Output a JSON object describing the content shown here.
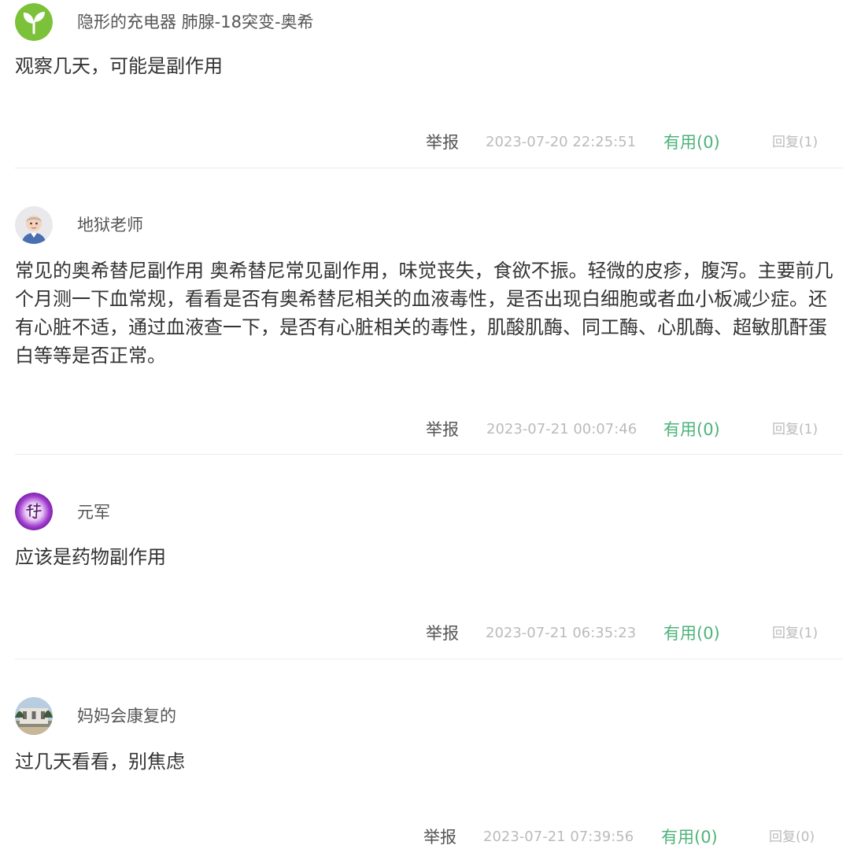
{
  "comments": [
    {
      "avatar": "leaf-sprout-avatar",
      "username": "隐形的充电器 肺腺-18突变-奥希",
      "content": "观察几天，可能是副作用",
      "report_label": "举报",
      "timestamp": "2023-07-20 22:25:51",
      "useful_label": "有用(0)",
      "reply_label": "回复(1)"
    },
    {
      "avatar": "baby-photo-avatar",
      "username": "地狱老师",
      "content": "常见的奥希替尼副作用 奥希替尼常见副作用，味觉丧失，食欲不振。轻微的皮疹，腹泻。主要前几个月测一下血常规，看看是否有奥希替尼相关的血液毒性，是否出现白细胞或者血小板减少症。还有心脏不适，通过血液查一下，是否有心脏相关的毒性，肌酸肌酶、同工酶、心肌酶、超敏肌酐蛋白等等是否正常。",
      "report_label": "举报",
      "timestamp": "2023-07-21 00:07:46",
      "useful_label": "有用(0)",
      "reply_label": "回复(1)"
    },
    {
      "avatar": "purple-calligraphy-avatar",
      "username": "元军",
      "content": "应该是药物副作用",
      "report_label": "举报",
      "timestamp": "2023-07-21 06:35:23",
      "useful_label": "有用(0)",
      "reply_label": "回复(1)"
    },
    {
      "avatar": "building-photo-avatar",
      "username": "妈妈会康复的",
      "content": "过几天看看，别焦虑",
      "report_label": "举报",
      "timestamp": "2023-07-21 07:39:56",
      "useful_label": "有用(0)",
      "reply_label": "回复(0)"
    }
  ],
  "colors": {
    "useful_green": "#4db37a",
    "muted_gray": "#bbbbbb",
    "text_dark": "#333333",
    "avatar_green": "#7cc13a",
    "avatar_purple": "#8a2fb5"
  }
}
